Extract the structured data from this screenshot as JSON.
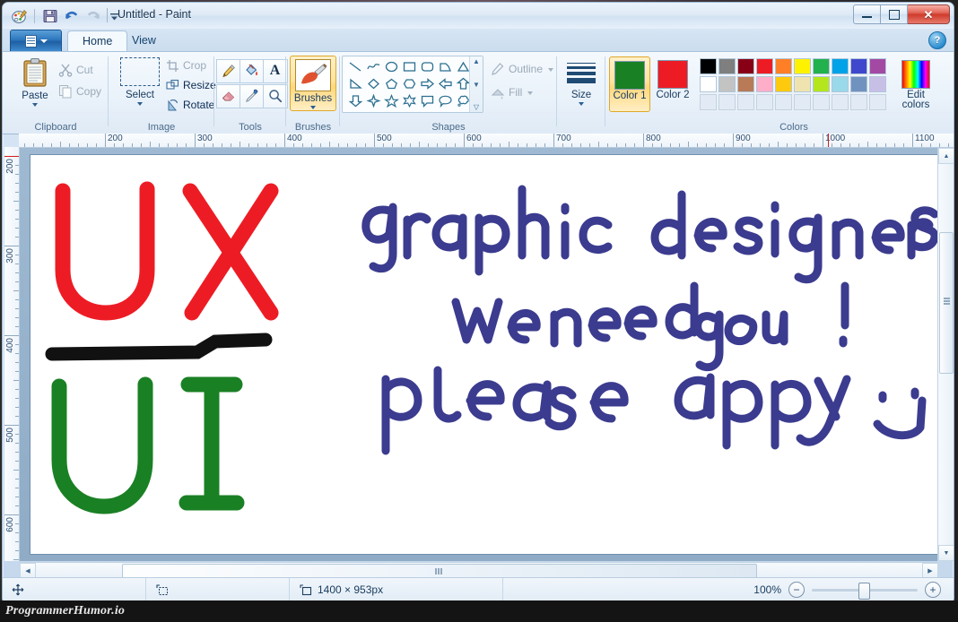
{
  "window": {
    "title": "Untitled - Paint",
    "quick_access": [
      {
        "name": "paint-logo-icon",
        "label": "Paint"
      },
      {
        "name": "save-icon",
        "label": "Save"
      },
      {
        "name": "undo-icon",
        "label": "Undo"
      },
      {
        "name": "redo-icon",
        "label": "Redo"
      },
      {
        "name": "customize-qat-icon",
        "label": "Customize Quick Access Toolbar"
      }
    ],
    "controls": [
      {
        "name": "minimize-button",
        "glyph": "–"
      },
      {
        "name": "maximize-button",
        "glyph": "□"
      },
      {
        "name": "close-button",
        "glyph": "✕"
      }
    ]
  },
  "tabs": {
    "app_button_label": "File",
    "items": [
      {
        "label": "Home",
        "active": true
      },
      {
        "label": "View",
        "active": false
      }
    ],
    "help_label": "?"
  },
  "ribbon": {
    "groups": [
      {
        "name": "clipboard",
        "label": "Clipboard",
        "paste_label": "Paste",
        "items": [
          {
            "label": "Cut",
            "icon": "scissors-icon",
            "disabled": true
          },
          {
            "label": "Copy",
            "icon": "copy-icon",
            "disabled": true
          }
        ]
      },
      {
        "name": "image",
        "label": "Image",
        "select_label": "Select",
        "items": [
          {
            "label": "Crop",
            "icon": "crop-icon",
            "disabled": true
          },
          {
            "label": "Resize",
            "icon": "resize-icon",
            "disabled": false
          },
          {
            "label": "Rotate",
            "icon": "rotate-icon",
            "disabled": false
          }
        ]
      },
      {
        "name": "tools",
        "label": "Tools",
        "items": [
          {
            "icon": "pencil-icon",
            "label": "Pencil"
          },
          {
            "icon": "fill-bucket-icon",
            "label": "Fill with color"
          },
          {
            "icon": "text-icon",
            "label": "Text"
          },
          {
            "icon": "eraser-icon",
            "label": "Eraser"
          },
          {
            "icon": "color-picker-icon",
            "label": "Color picker"
          },
          {
            "icon": "magnifier-icon",
            "label": "Magnifier"
          }
        ]
      },
      {
        "name": "brushes",
        "label": "Brushes",
        "brushes_label": "Brushes",
        "selected": true
      },
      {
        "name": "shapes",
        "label": "Shapes",
        "outline_label": "Outline",
        "fill_label": "Fill",
        "outline_disabled": true,
        "fill_disabled": true,
        "items": [
          "line",
          "curve",
          "oval",
          "rectangle",
          "rounded-rectangle",
          "polygon",
          "triangle",
          "right-triangle",
          "diamond",
          "pentagon",
          "hexagon",
          "right-arrow",
          "left-arrow",
          "up-arrow",
          "down-arrow",
          "four-point-star",
          "five-point-star",
          "six-point-star",
          "rectangular-callout",
          "rounded-callout",
          "cloud-callout"
        ]
      },
      {
        "name": "size",
        "label": "",
        "size_label": "Size"
      },
      {
        "name": "colors",
        "label": "Colors",
        "color1_label": "Color 1",
        "color2_label": "Color 2",
        "color1_value": "#1a8024",
        "color2_value": "#ed1c24",
        "edit_colors_label": "Edit colors",
        "palette_row1": [
          "#000000",
          "#7f7f7f",
          "#880015",
          "#ed1c24",
          "#ff7f27",
          "#fff200",
          "#22b14c",
          "#00a2e8",
          "#3f48cc",
          "#a349a4"
        ],
        "palette_row2": [
          "#ffffff",
          "#c3c3c3",
          "#b97a57",
          "#ffaec9",
          "#ffc90e",
          "#efe4b0",
          "#b5e61d",
          "#99d9ea",
          "#7092be",
          "#c8bfe7"
        ],
        "palette_row3": [
          "",
          "",
          "",
          "",
          "",
          "",
          "",
          "",
          "",
          ""
        ]
      }
    ]
  },
  "rulers": {
    "horizontal_ticks": [
      "200",
      "300",
      "400",
      "500",
      "600",
      "700",
      "800",
      "900",
      "1000",
      "1100"
    ],
    "vertical_ticks": [
      "200",
      "300",
      "400",
      "500",
      "600"
    ]
  },
  "canvas": {
    "drawing_description": "Handwritten marker drawing: UX over UI as a fraction, and blue text",
    "strokes": [
      {
        "name": "ux-letters",
        "text": "UX",
        "color": "#ed1c24"
      },
      {
        "name": "fraction-bar",
        "text": "",
        "color": "#000000"
      },
      {
        "name": "ui-letters",
        "text": "UI",
        "color": "#1a8024"
      },
      {
        "name": "line-1",
        "text": "graphic designers",
        "color": "#3b3b8f"
      },
      {
        "name": "line-2",
        "text": "we need you !",
        "color": "#3b3b8f"
      },
      {
        "name": "line-3",
        "text": "please apply",
        "color": "#3b3b8f"
      },
      {
        "name": "smiley",
        "text": ":)",
        "color": "#3b3b8f"
      }
    ]
  },
  "status": {
    "cursor_position": "",
    "selection_size": "",
    "image_size": "1400 × 953px",
    "zoom_level": "100%",
    "zoom_out_label": "−",
    "zoom_in_label": "+"
  },
  "watermark": {
    "text": "ProgrammerHumor.io"
  }
}
